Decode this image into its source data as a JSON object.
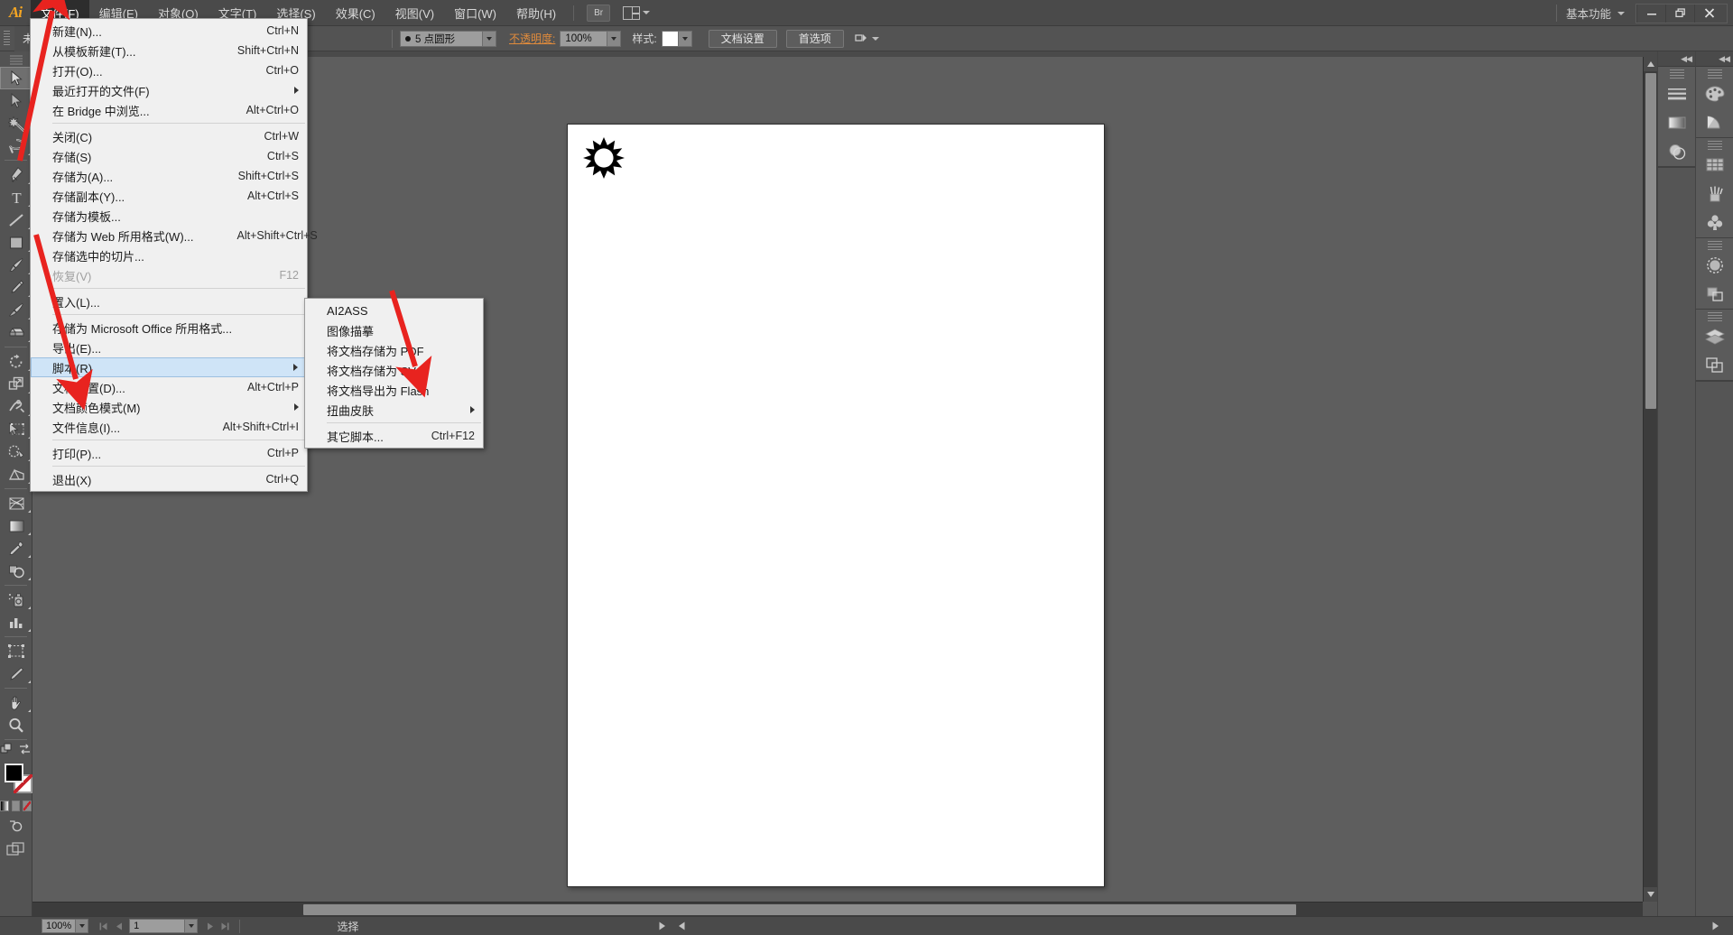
{
  "app": {
    "name": "Ai",
    "logo_label": "Ai"
  },
  "menubar": {
    "items": [
      {
        "label": "文件(F)",
        "active": true
      },
      {
        "label": "编辑(E)",
        "active": false
      },
      {
        "label": "对象(O)",
        "active": false
      },
      {
        "label": "文字(T)",
        "active": false
      },
      {
        "label": "选择(S)",
        "active": false
      },
      {
        "label": "效果(C)",
        "active": false
      },
      {
        "label": "视图(V)",
        "active": false
      },
      {
        "label": "窗口(W)",
        "active": false
      },
      {
        "label": "帮助(H)",
        "active": false
      }
    ],
    "bridge_button": "Br",
    "arrange_icon": "arrange-documents-icon",
    "workspace_name": "基本功能",
    "window_buttons": {
      "minimize": "—",
      "restore": "❐",
      "close": "✕"
    }
  },
  "controlbar": {
    "no_selection": "未选",
    "brush_value": "5 点圆形",
    "opacity_label": "不透明度:",
    "opacity_value": "100%",
    "style_label": "样式:",
    "doc_setup_button": "文档设置",
    "preferences_button": "首选项"
  },
  "file_menu": {
    "rows": [
      {
        "label": "新建(N)...",
        "key": "Ctrl+N"
      },
      {
        "label": "从模板新建(T)...",
        "key": "Shift+Ctrl+N"
      },
      {
        "label": "打开(O)...",
        "key": "Ctrl+O"
      },
      {
        "label": "最近打开的文件(F)",
        "key": "",
        "submenu": true
      },
      {
        "label": "在 Bridge 中浏览...",
        "key": "Alt+Ctrl+O"
      },
      {
        "divider": true
      },
      {
        "label": "关闭(C)",
        "key": "Ctrl+W"
      },
      {
        "label": "存储(S)",
        "key": "Ctrl+S"
      },
      {
        "label": "存储为(A)...",
        "key": "Shift+Ctrl+S"
      },
      {
        "label": "存储副本(Y)...",
        "key": "Alt+Ctrl+S"
      },
      {
        "label": "存储为模板...",
        "key": ""
      },
      {
        "label": "存储为 Web 所用格式(W)...",
        "key": "Alt+Shift+Ctrl+S"
      },
      {
        "label": "存储选中的切片...",
        "key": ""
      },
      {
        "label": "恢复(V)",
        "key": "F12",
        "disabled": true
      },
      {
        "divider": true
      },
      {
        "label": "置入(L)...",
        "key": ""
      },
      {
        "divider": true
      },
      {
        "label": "存储为 Microsoft Office 所用格式...",
        "key": ""
      },
      {
        "label": "导出(E)...",
        "key": ""
      },
      {
        "label": "脚本(R)",
        "key": "",
        "submenu": true,
        "highlighted": true
      },
      {
        "label": "文档设置(D)...",
        "key": "Alt+Ctrl+P"
      },
      {
        "label": "文档颜色模式(M)",
        "key": "",
        "submenu": true
      },
      {
        "label": "文件信息(I)...",
        "key": "Alt+Shift+Ctrl+I"
      },
      {
        "divider": true
      },
      {
        "label": "打印(P)...",
        "key": "Ctrl+P"
      },
      {
        "divider": true
      },
      {
        "label": "退出(X)",
        "key": "Ctrl+Q"
      }
    ]
  },
  "scripts_submenu": {
    "rows": [
      {
        "label": "AI2ASS",
        "key": ""
      },
      {
        "label": "图像描摹",
        "key": ""
      },
      {
        "label": "将文档存储为 PDF",
        "key": ""
      },
      {
        "label": "将文档存储为 SVG",
        "key": ""
      },
      {
        "label": "将文档导出为 Flash",
        "key": ""
      },
      {
        "label": "扭曲皮肤",
        "key": "",
        "submenu": true
      },
      {
        "divider": true
      },
      {
        "label": "其它脚本...",
        "key": "Ctrl+F12"
      }
    ]
  },
  "toolbar": {
    "tools": [
      {
        "name": "selection-tool",
        "selected": true
      },
      {
        "name": "direct-selection-tool",
        "selected": false
      },
      {
        "name": "magic-wand-tool",
        "selected": false
      },
      {
        "name": "lasso-tool",
        "selected": false
      },
      {
        "name": "pen-tool",
        "selected": false
      },
      {
        "name": "type-tool",
        "selected": false
      },
      {
        "name": "line-segment-tool",
        "selected": false
      },
      {
        "name": "rectangle-tool",
        "selected": false
      },
      {
        "name": "paintbrush-tool",
        "selected": false
      },
      {
        "name": "pencil-tool",
        "selected": false
      },
      {
        "name": "blob-brush-tool",
        "selected": false
      },
      {
        "name": "eraser-tool",
        "selected": false
      },
      {
        "name": "rotate-tool",
        "selected": false
      },
      {
        "name": "scale-tool",
        "selected": false
      },
      {
        "name": "width-tool",
        "selected": false
      },
      {
        "name": "free-transform-tool",
        "selected": false
      },
      {
        "name": "shape-builder-tool",
        "selected": false
      },
      {
        "name": "perspective-grid-tool",
        "selected": false
      },
      {
        "name": "mesh-tool",
        "selected": false
      },
      {
        "name": "gradient-tool",
        "selected": false
      },
      {
        "name": "eyedropper-tool",
        "selected": false
      },
      {
        "name": "blend-tool",
        "selected": false
      },
      {
        "name": "symbol-sprayer-tool",
        "selected": false
      },
      {
        "name": "column-graph-tool",
        "selected": false
      },
      {
        "name": "artboard-tool",
        "selected": false
      },
      {
        "name": "slice-tool",
        "selected": false
      },
      {
        "name": "hand-tool",
        "selected": false
      },
      {
        "name": "zoom-tool",
        "selected": false
      }
    ],
    "fill_color": "#000000",
    "stroke_color": "#ffffff"
  },
  "dock": {
    "groups_left": [
      "stroke-panel-icon",
      "gradient-panel-icon",
      "transparency-panel-icon"
    ],
    "groups_right": [
      [
        "color-panel-icon",
        "color-guide-panel-icon"
      ],
      [
        "swatches-panel-icon",
        "brushes-panel-icon",
        "symbols-panel-icon"
      ],
      [
        "appearance-panel-icon",
        "graphic-styles-panel-icon"
      ],
      [
        "layers-panel-icon",
        "artboards-panel-icon"
      ]
    ],
    "collapse_glyph": "◀◀"
  },
  "canvas": {
    "artwork_name": "sun-shape",
    "artwork_fill": "#000000"
  },
  "statusbar": {
    "zoom": "100%",
    "page": "1",
    "status_text": "选择"
  },
  "annotations": {
    "arrow_color": "#e8231f",
    "arrows": [
      {
        "name": "arrow-to-file-menu"
      },
      {
        "name": "arrow-to-scripts-item"
      },
      {
        "name": "arrow-to-ai2ass-item"
      }
    ]
  }
}
